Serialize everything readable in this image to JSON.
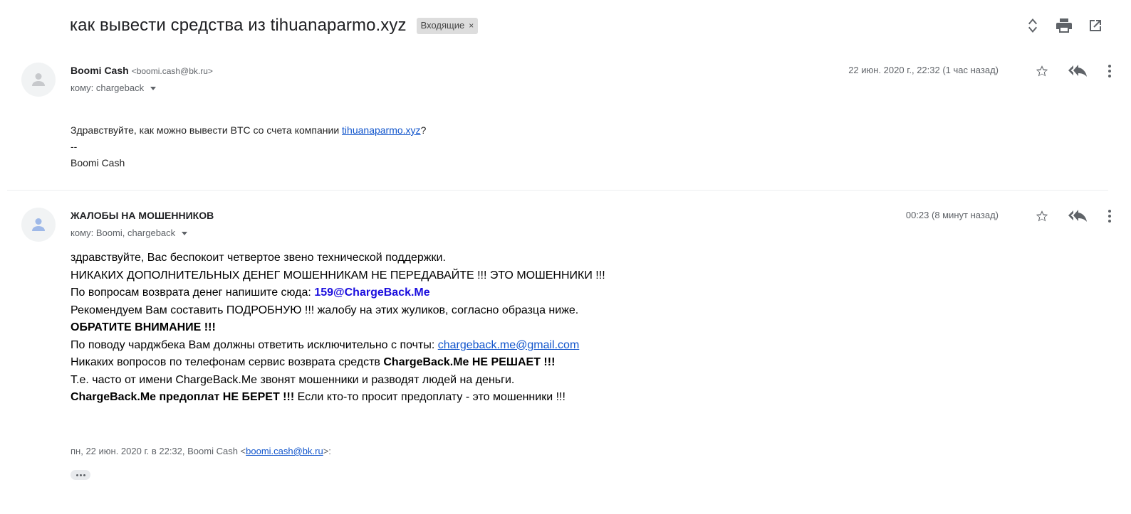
{
  "subject": "как вывести средства из tihuanaparmo.xyz",
  "label_chip": {
    "text": "Входящие",
    "close": "×"
  },
  "messages": [
    {
      "sender_name": "Boomi Cash",
      "sender_email": "<boomi.cash@bk.ru>",
      "to": "кому: chargeback",
      "date": "22 июн. 2020 г., 22:32 (1 час назад)",
      "body": {
        "line1_pre": "Здравствуйте, как можно вывести BTC со счета компании ",
        "line1_link": "tihuanaparmo.xyz",
        "line1_post": "?",
        "sig_sep": "--",
        "sig_name": "Boomi Cash"
      }
    },
    {
      "sender_name": "ЖАЛОБЫ НА МОШЕННИКОВ",
      "sender_email": "",
      "to": "кому: Boomi, chargeback",
      "date": "00:23 (8 минут назад)",
      "body": {
        "l1": "здравствуйте, Вас беспокоит четвертое звено технической поддержки.",
        "l2": "НИКАКИХ ДОПОЛНИТЕЛЬНЫХ ДЕНЕГ МОШЕННИКАМ НЕ ПЕРЕДАВАЙТЕ !!! ЭТО МОШЕННИКИ !!!",
        "l3_pre": "По вопросам возврата денег напишите сюда: ",
        "l3_email": "159@ChargeBack.Me",
        "l4": "Рекомендуем Вам составить ПОДРОБНУЮ !!! жалобу на этих жуликов, согласно образца ниже.",
        "l5": "ОБРАТИТЕ ВНИМАНИЕ !!!",
        "l6_pre": "По поводу чарджбека Вам должны ответить исключительно с почты: ",
        "l6_link": "chargeback.me@gmail.com",
        "l7_pre": "Никаких вопросов по телефонам сервис возврата средств ",
        "l7_bold": "ChargeBack.Me НЕ РЕШАЕТ !!!",
        "l8": "Т.е. часто от имени ChargeBack.Me звонят мошенники и разводят людей на деньги.",
        "l9_bold": "ChargeBack.Me предоплат НЕ БЕРЕТ !!!",
        "l9_post": " Если кто-то просит предоплату - это мошенники !!!"
      },
      "quote": {
        "pre": "пн, 22 июн. 2020 г. в 22:32, Boomi Cash <",
        "link": "boomi.cash@bk.ru",
        "post": ">:"
      }
    }
  ],
  "icons": {
    "top": [
      "expand-collapse-icon",
      "print-icon",
      "open-in-new-window-icon"
    ],
    "message": [
      "star-icon",
      "reply-all-icon",
      "more-vert-icon"
    ]
  }
}
